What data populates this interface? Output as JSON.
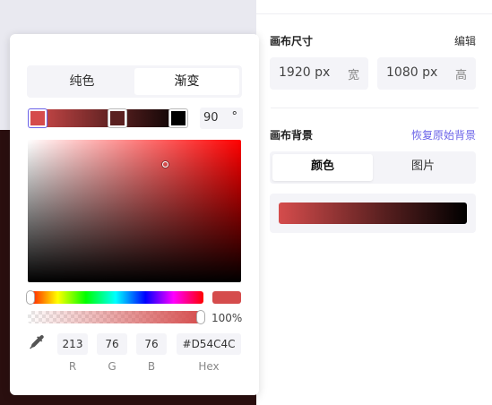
{
  "panel": {
    "canvas_size_title": "画布尺寸",
    "edit_label": "编辑",
    "width_value": "1920 px",
    "width_unit": "宽",
    "height_value": "1080 px",
    "height_unit": "高",
    "canvas_bg_title": "画布背景",
    "restore_label": "恢复原始背景",
    "bg_tabs": [
      "颜色",
      "图片"
    ],
    "bg_active_tab": "颜色"
  },
  "picker": {
    "tabs": [
      "纯色",
      "渐变"
    ],
    "active_tab": "渐变",
    "gradient": {
      "angle": "90",
      "angle_unit": "°",
      "stops": [
        "#D54C4C",
        "#5a2020",
        "#000000"
      ],
      "selected_stop": 0
    },
    "hue": 0,
    "alpha": "100%",
    "r": "213",
    "g": "76",
    "b": "76",
    "hex": "#D54C4C",
    "labels": {
      "r": "R",
      "g": "G",
      "b": "B",
      "hex": "Hex"
    }
  },
  "colors": {
    "accent": "#6b63e8",
    "current": "#D54C4C"
  },
  "icons": [
    "eyedropper-icon"
  ]
}
